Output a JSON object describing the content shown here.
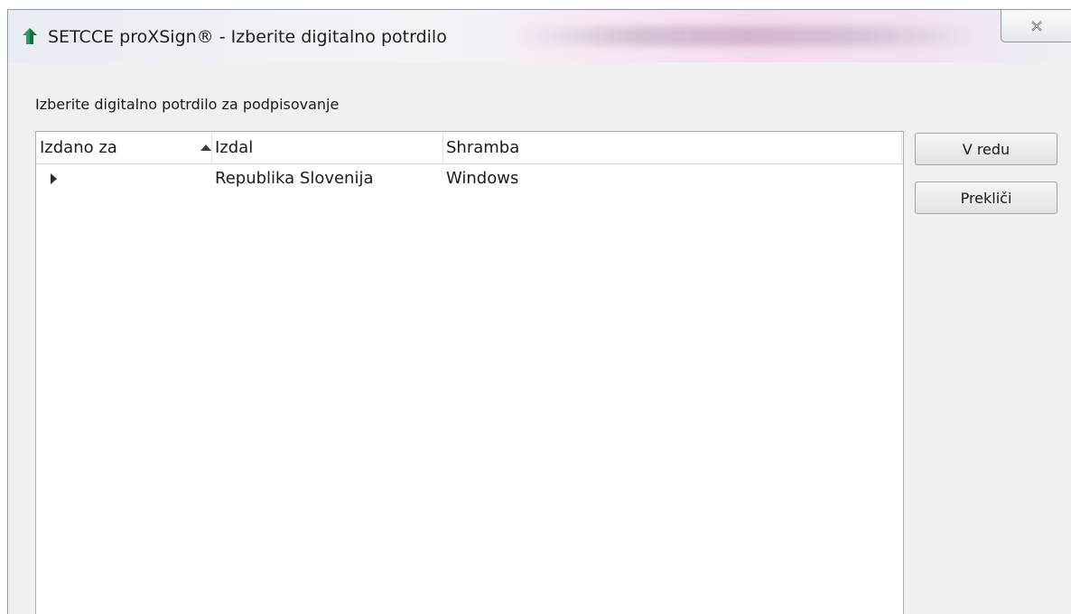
{
  "window": {
    "title": "SETCCE proXSign® - Izberite digitalno potrdilo",
    "app_icon": "proxsign-logo-icon",
    "close_icon": "close-icon"
  },
  "dialog": {
    "instruction": "Izberite digitalno potrdilo za podpisovanje",
    "ok_label": "V redu",
    "cancel_label": "Prekliči"
  },
  "table": {
    "columns": [
      "Izdano za",
      "Izdal",
      "Shramba"
    ],
    "sorted_column": "Izdano za",
    "sort_direction": "ascending",
    "rows": [
      {
        "issued_to": "",
        "issuer": "Republika Slovenija",
        "store": "Windows",
        "expandable": true
      }
    ]
  },
  "colors": {
    "window_bg": "#f0f0f0",
    "list_bg": "#ffffff",
    "icon_green": "#2e9a5a"
  }
}
